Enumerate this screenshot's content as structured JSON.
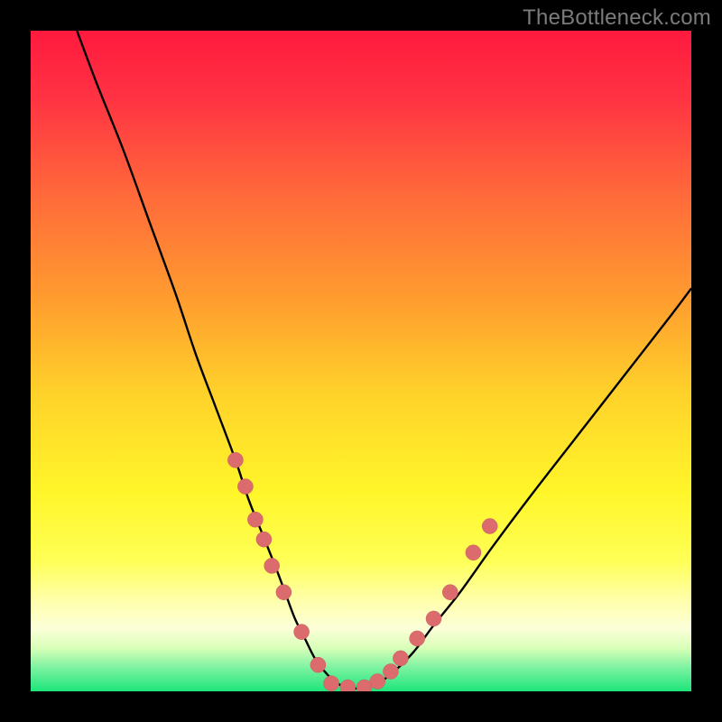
{
  "watermark": "TheBottleneck.com",
  "colors": {
    "black": "#000000",
    "curve": "#000000",
    "dot_fill": "#db6b6c",
    "dot_stroke": "#c95b5c"
  },
  "gradient_stops": [
    {
      "offset": 0.0,
      "color": "#ff1a3e"
    },
    {
      "offset": 0.1,
      "color": "#ff3243"
    },
    {
      "offset": 0.25,
      "color": "#ff6a3a"
    },
    {
      "offset": 0.4,
      "color": "#ff9a2f"
    },
    {
      "offset": 0.55,
      "color": "#ffd22a"
    },
    {
      "offset": 0.7,
      "color": "#fff62a"
    },
    {
      "offset": 0.8,
      "color": "#ffff55"
    },
    {
      "offset": 0.86,
      "color": "#ffffa8"
    },
    {
      "offset": 0.905,
      "color": "#fcffd8"
    },
    {
      "offset": 0.935,
      "color": "#d8ffb8"
    },
    {
      "offset": 0.965,
      "color": "#7af2a0"
    },
    {
      "offset": 1.0,
      "color": "#1de57a"
    }
  ],
  "chart_data": {
    "type": "line",
    "title": "",
    "xlabel": "",
    "ylabel": "",
    "xlim": [
      0,
      100
    ],
    "ylim": [
      0,
      100
    ],
    "series": [
      {
        "name": "bottleneck-curve",
        "x": [
          7,
          10,
          14,
          18,
          22,
          25,
          28,
          31,
          33,
          35,
          37,
          38.5,
          40,
          41.5,
          43,
          44.5,
          46,
          48,
          50,
          52.5,
          55,
          58,
          61,
          65,
          70,
          76,
          83,
          90,
          97,
          100
        ],
        "y": [
          100,
          92,
          82,
          71,
          60,
          51,
          43,
          35,
          29,
          24,
          19,
          15,
          11,
          8,
          5,
          3,
          1.5,
          0.5,
          0.5,
          1.2,
          3,
          6,
          10,
          15,
          22,
          30,
          39,
          48,
          57,
          61
        ]
      }
    ],
    "dots_left": [
      {
        "x": 31.0,
        "y": 35
      },
      {
        "x": 32.5,
        "y": 31
      },
      {
        "x": 34.0,
        "y": 26
      },
      {
        "x": 35.3,
        "y": 23
      },
      {
        "x": 36.5,
        "y": 19
      },
      {
        "x": 38.3,
        "y": 15
      },
      {
        "x": 41.0,
        "y": 9
      },
      {
        "x": 43.5,
        "y": 4
      }
    ],
    "dots_right": [
      {
        "x": 52.5,
        "y": 1.5
      },
      {
        "x": 54.5,
        "y": 3
      },
      {
        "x": 56.0,
        "y": 5
      },
      {
        "x": 58.5,
        "y": 8
      },
      {
        "x": 61.0,
        "y": 11
      },
      {
        "x": 63.5,
        "y": 15
      },
      {
        "x": 67.0,
        "y": 21
      },
      {
        "x": 69.5,
        "y": 25
      }
    ],
    "dots_bottom": [
      {
        "x": 45.5,
        "y": 1.2
      },
      {
        "x": 48.0,
        "y": 0.6
      },
      {
        "x": 50.5,
        "y": 0.6
      }
    ]
  }
}
